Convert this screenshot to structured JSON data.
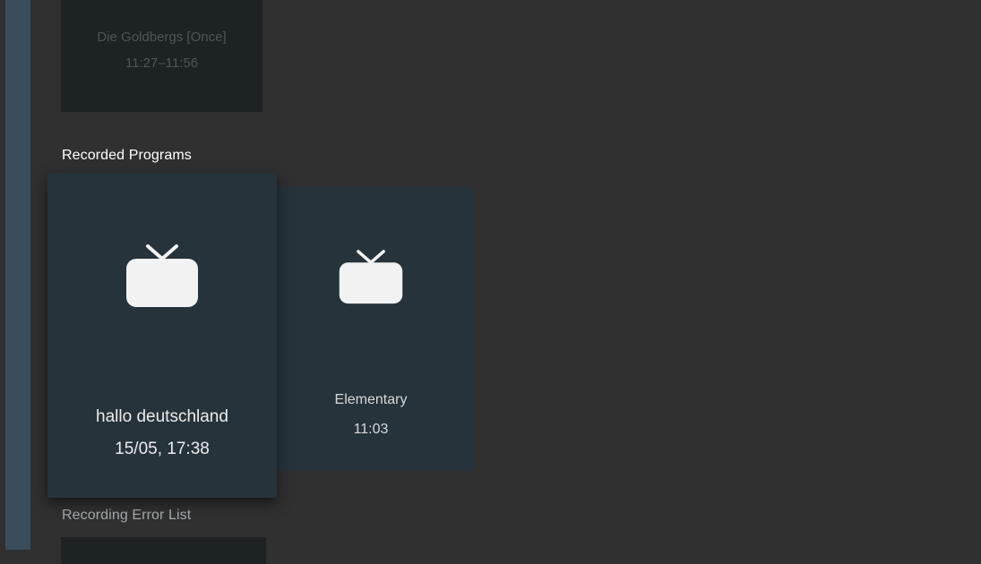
{
  "scheduled": {
    "card": {
      "title": "Die Goldbergs [Once]",
      "time": "11:27–11:56"
    }
  },
  "recorded": {
    "header": "Recorded Programs",
    "items": [
      {
        "title": "hallo deutschland",
        "time": "15/05, 17:38",
        "icon": "tv-icon",
        "focused": true
      },
      {
        "title": "Elementary",
        "time": "11:03",
        "icon": "tv-icon",
        "focused": false
      }
    ]
  },
  "errors": {
    "header": "Recording Error List"
  },
  "colors": {
    "background": "#303030",
    "card": "#26333b",
    "rail": "#3a4d5c"
  }
}
